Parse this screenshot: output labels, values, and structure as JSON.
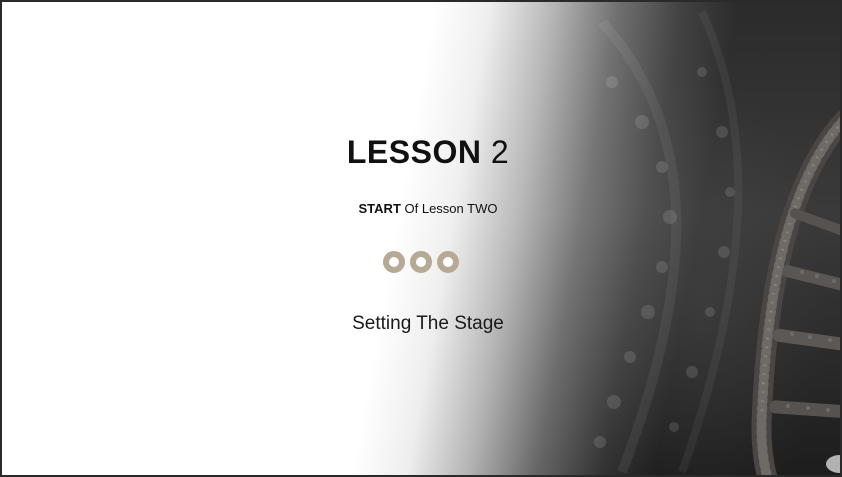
{
  "slide": {
    "title_bold": "LESSON",
    "title_number": "2",
    "subtitle_bold": "START",
    "subtitle_rest": "Of Lesson TWO",
    "caption": "Setting The Stage"
  },
  "decor": {
    "dot_count": 3,
    "dot_color": "#b6a995",
    "background_image": "dna-helix",
    "background_tone": "#2b2b2b"
  }
}
